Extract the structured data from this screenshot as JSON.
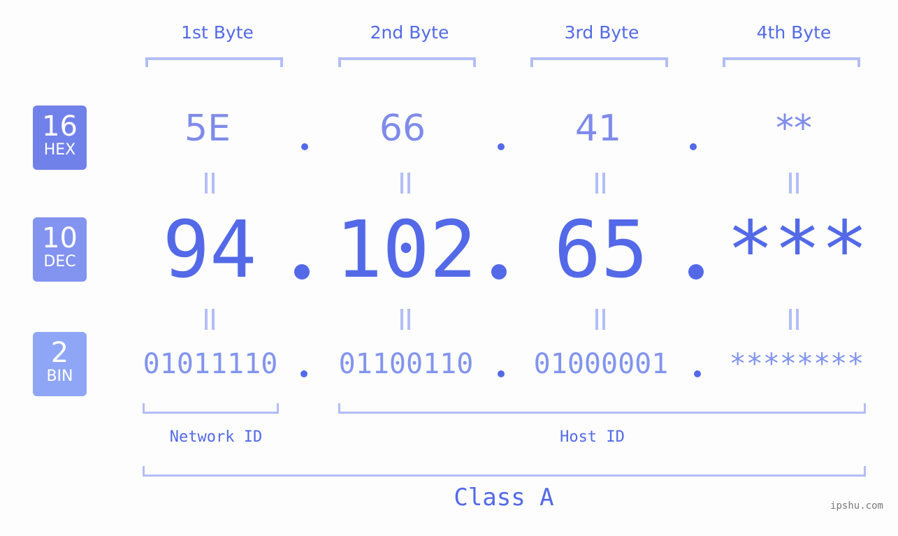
{
  "byte_headers": [
    "1st Byte",
    "2nd Byte",
    "3rd Byte",
    "4th Byte"
  ],
  "badges": {
    "hex": {
      "number": "16",
      "label": "HEX",
      "color": "#7181ea"
    },
    "dec": {
      "number": "10",
      "label": "DEC",
      "color": "#8393f0"
    },
    "bin": {
      "number": "2",
      "label": "BIN",
      "color": "#8fa6f6"
    }
  },
  "hex": [
    "5E",
    "66",
    "41",
    "**"
  ],
  "dec": [
    "94",
    "102",
    "65",
    "***"
  ],
  "bin": [
    "01011110",
    "01100110",
    "01000001",
    "********"
  ],
  "labels": {
    "network_id": "Network ID",
    "host_id": "Host ID",
    "class": "Class A"
  },
  "watermark": "ipshu.com",
  "colors": {
    "primary": "#5369e8",
    "hex_text": "#7e8bea",
    "bin_text": "#8294ee",
    "bracket": "#b3bdf7",
    "background": "#fcfdfc"
  }
}
